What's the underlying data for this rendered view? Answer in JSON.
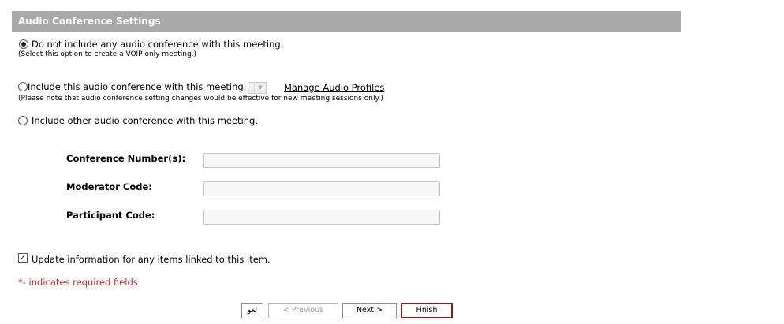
{
  "section": {
    "title": "Audio Conference Settings"
  },
  "options": {
    "no_audio": {
      "label": "Do not include any audio conference with this meeting.",
      "note": "(Select this option to create a VOIP only meeting.)",
      "checked": true
    },
    "include_this": {
      "label": "Include this audio conference with this meeting:",
      "note": "(Please note that audio conference setting changes would be effective for new meeting sessions only.)",
      "profile_value": "",
      "manage_link": "Manage Audio Profiles",
      "checked": false
    },
    "include_other": {
      "label": "Include other audio conference with this meeting.",
      "checked": false
    }
  },
  "fields": {
    "conference_number": {
      "label": "Conference Number(s):",
      "value": ""
    },
    "moderator_code": {
      "label": "Moderator Code:",
      "value": ""
    },
    "participant_code": {
      "label": "Participant Code:",
      "value": ""
    }
  },
  "update_linked": {
    "label": "Update information for any items linked to this item.",
    "checked": true
  },
  "required_note": "*- indicates required fields",
  "buttons": {
    "cancel": "لغو",
    "previous": "< Previous",
    "next": "Next >",
    "finish": "Finish"
  },
  "colors": {
    "header_bg": "#a9a9a9",
    "required_text": "#c0282a",
    "finish_border": "#8b1a1a"
  }
}
